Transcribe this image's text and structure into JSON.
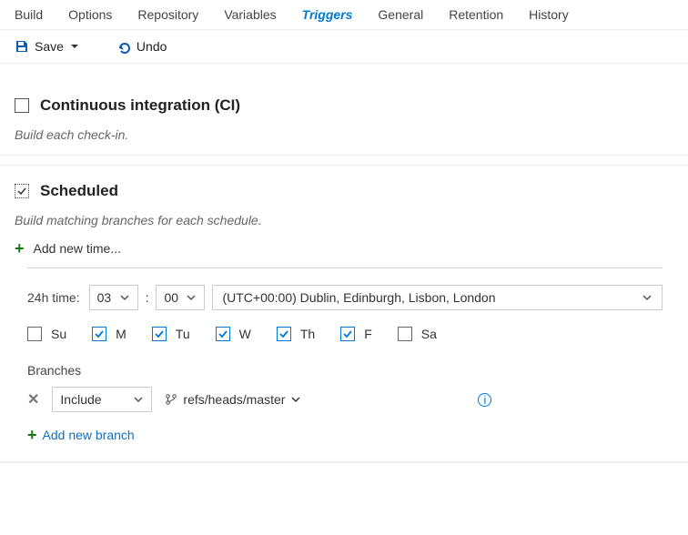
{
  "tabs": {
    "items": [
      "Build",
      "Options",
      "Repository",
      "Variables",
      "Triggers",
      "General",
      "Retention",
      "History"
    ],
    "active": "Triggers"
  },
  "toolbar": {
    "save": "Save",
    "undo": "Undo"
  },
  "ci": {
    "title": "Continuous integration (CI)",
    "desc": "Build each check-in."
  },
  "scheduled": {
    "title": "Scheduled",
    "desc": "Build matching branches for each schedule.",
    "add_time": "Add new time...",
    "time_label": "24h time:",
    "hour": "03",
    "minute": "00",
    "timezone": "(UTC+00:00) Dublin, Edinburgh, Lisbon, London",
    "days": [
      {
        "label": "Su",
        "checked": false
      },
      {
        "label": "M",
        "checked": true
      },
      {
        "label": "Tu",
        "checked": true
      },
      {
        "label": "W",
        "checked": true
      },
      {
        "label": "Th",
        "checked": true
      },
      {
        "label": "F",
        "checked": true
      },
      {
        "label": "Sa",
        "checked": false
      }
    ],
    "branches_label": "Branches",
    "branch_filter": {
      "mode": "Include",
      "ref": "refs/heads/master"
    },
    "add_branch": "Add new branch"
  }
}
